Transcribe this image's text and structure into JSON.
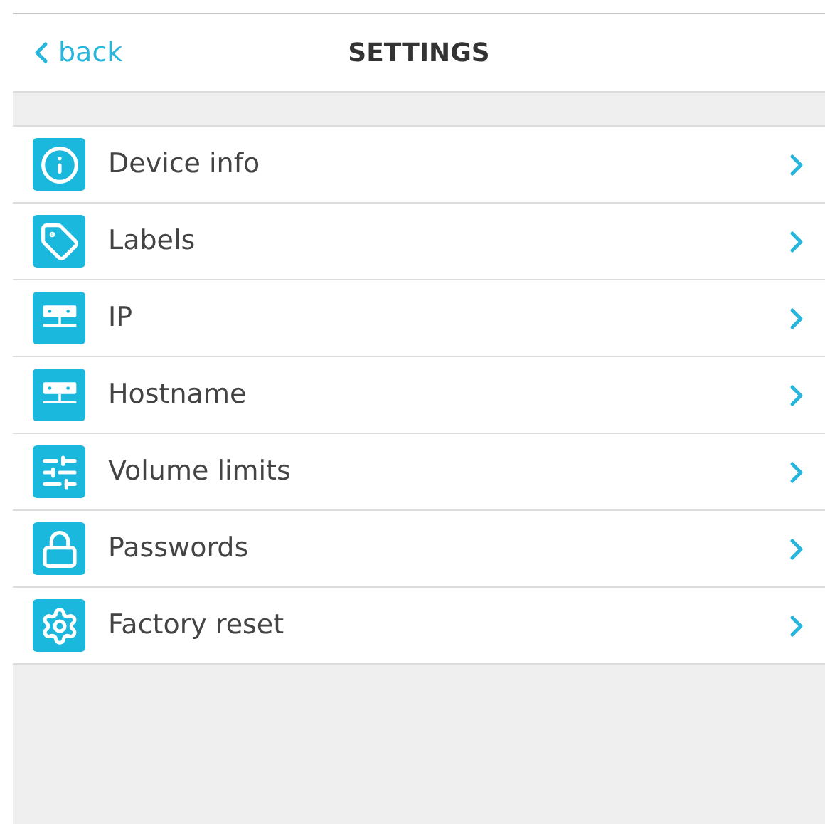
{
  "header": {
    "back": "back",
    "title": "SETTINGS"
  },
  "items": [
    {
      "kind": "info",
      "label": "Device info"
    },
    {
      "kind": "tag",
      "label": "Labels"
    },
    {
      "kind": "network",
      "label": "IP"
    },
    {
      "kind": "network",
      "label": "Hostname"
    },
    {
      "kind": "sliders",
      "label": "Volume limits"
    },
    {
      "kind": "lock",
      "label": "Passwords"
    },
    {
      "kind": "gear",
      "label": "Factory reset"
    }
  ]
}
